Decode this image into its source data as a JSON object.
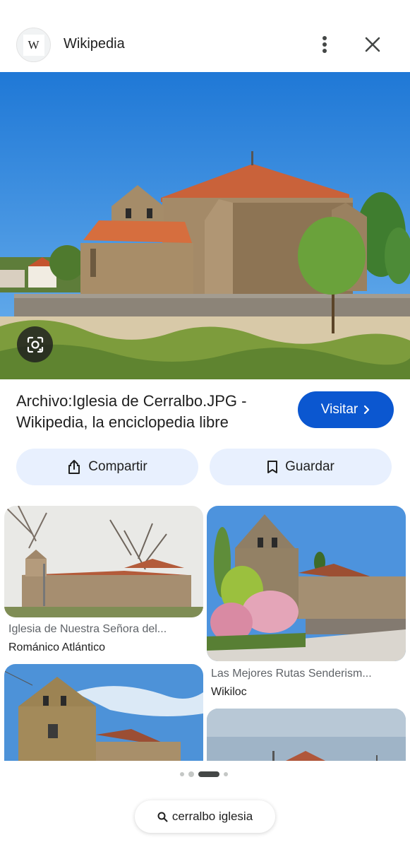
{
  "header": {
    "site_logo_letter": "W",
    "site_name": "Wikipedia",
    "more_icon": "more-vert-icon",
    "close_icon": "close-icon"
  },
  "hero": {
    "lens_icon": "google-lens-icon"
  },
  "result": {
    "title": "Archivo:Iglesia de Cerralbo.JPG - Wikipedia, la enciclopedia libre",
    "visit_label": "Visitar",
    "visit_icon": "chevron-right-icon"
  },
  "actions": {
    "share_label": "Compartir",
    "share_icon": "share-icon",
    "save_label": "Guardar",
    "save_icon": "bookmark-icon"
  },
  "related": [
    {
      "title": "Iglesia de Nuestra Señora del...",
      "source": "Románico Atlántico"
    },
    {
      "title": "Las Mejores Rutas Senderism...",
      "source": "Wikiloc"
    },
    {
      "title": "",
      "source": ""
    },
    {
      "title": "",
      "source": ""
    }
  ],
  "pagination": {
    "count": 4,
    "active_index": 2
  },
  "search": {
    "query": "cerralbo iglesia",
    "icon": "search-icon"
  },
  "colors": {
    "accent": "#0b57d0",
    "chip_bg": "#e8f0fe",
    "sky": "#3d8fe0"
  }
}
